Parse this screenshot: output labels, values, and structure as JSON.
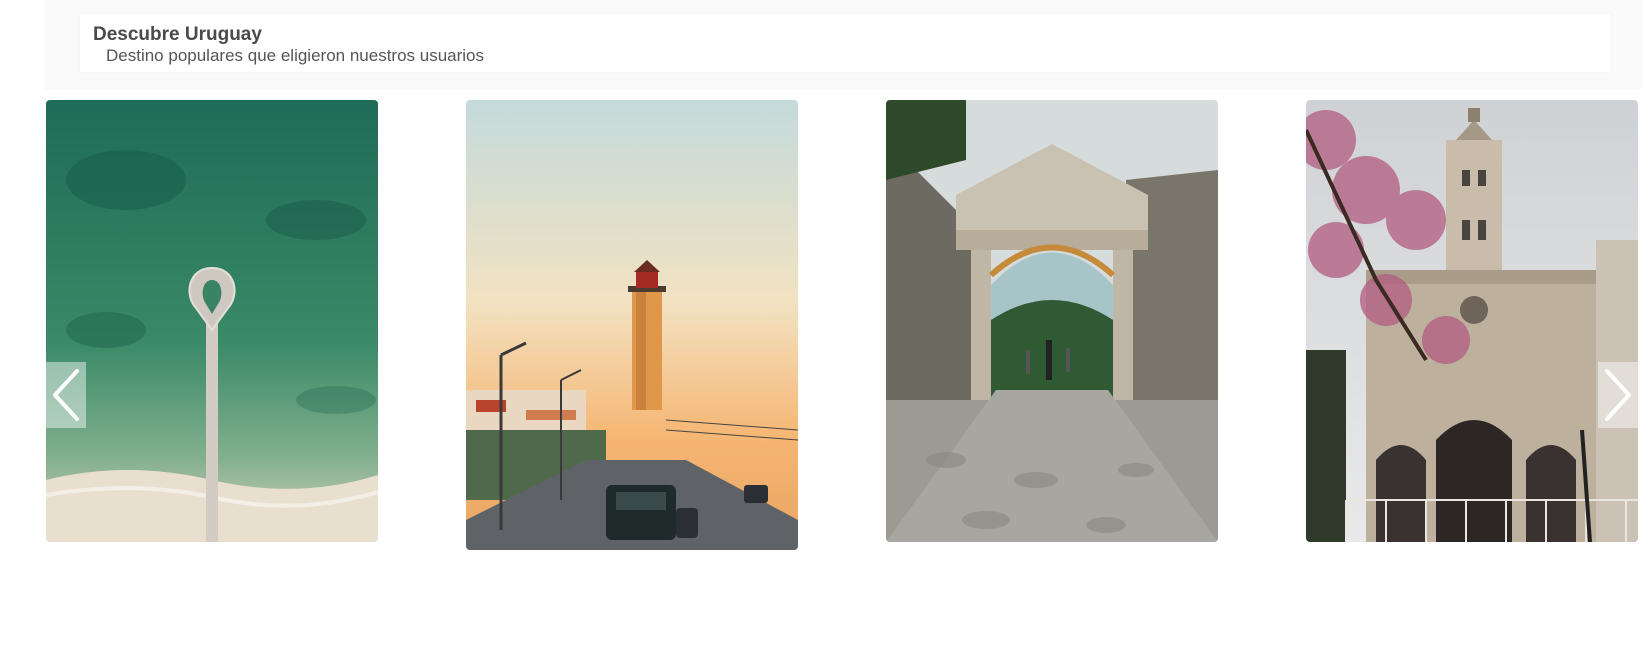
{
  "section": {
    "title": "Descubre Uruguay",
    "subtitle": "Destino populares que eligieron nuestros usuarios"
  },
  "carousel": {
    "prev_icon": "chevron-left-icon",
    "next_icon": "chevron-right-icon",
    "items": [
      {
        "image": "aerial-pier-beach",
        "colors": {
          "sea": "#2f7a5e",
          "sand": "#e6dccd"
        }
      },
      {
        "image": "lighthouse-street-sunset",
        "colors": {
          "sky_top": "#c9dcdc",
          "sky_bottom": "#f5b978"
        }
      },
      {
        "image": "stone-city-gate-cobblestone",
        "colors": {
          "stone": "#8f8a80",
          "sky": "#d9dedd"
        }
      },
      {
        "image": "cathedral-pink-tree",
        "colors": {
          "facade": "#b9ab98",
          "blossom": "#b05a7a"
        }
      }
    ]
  }
}
